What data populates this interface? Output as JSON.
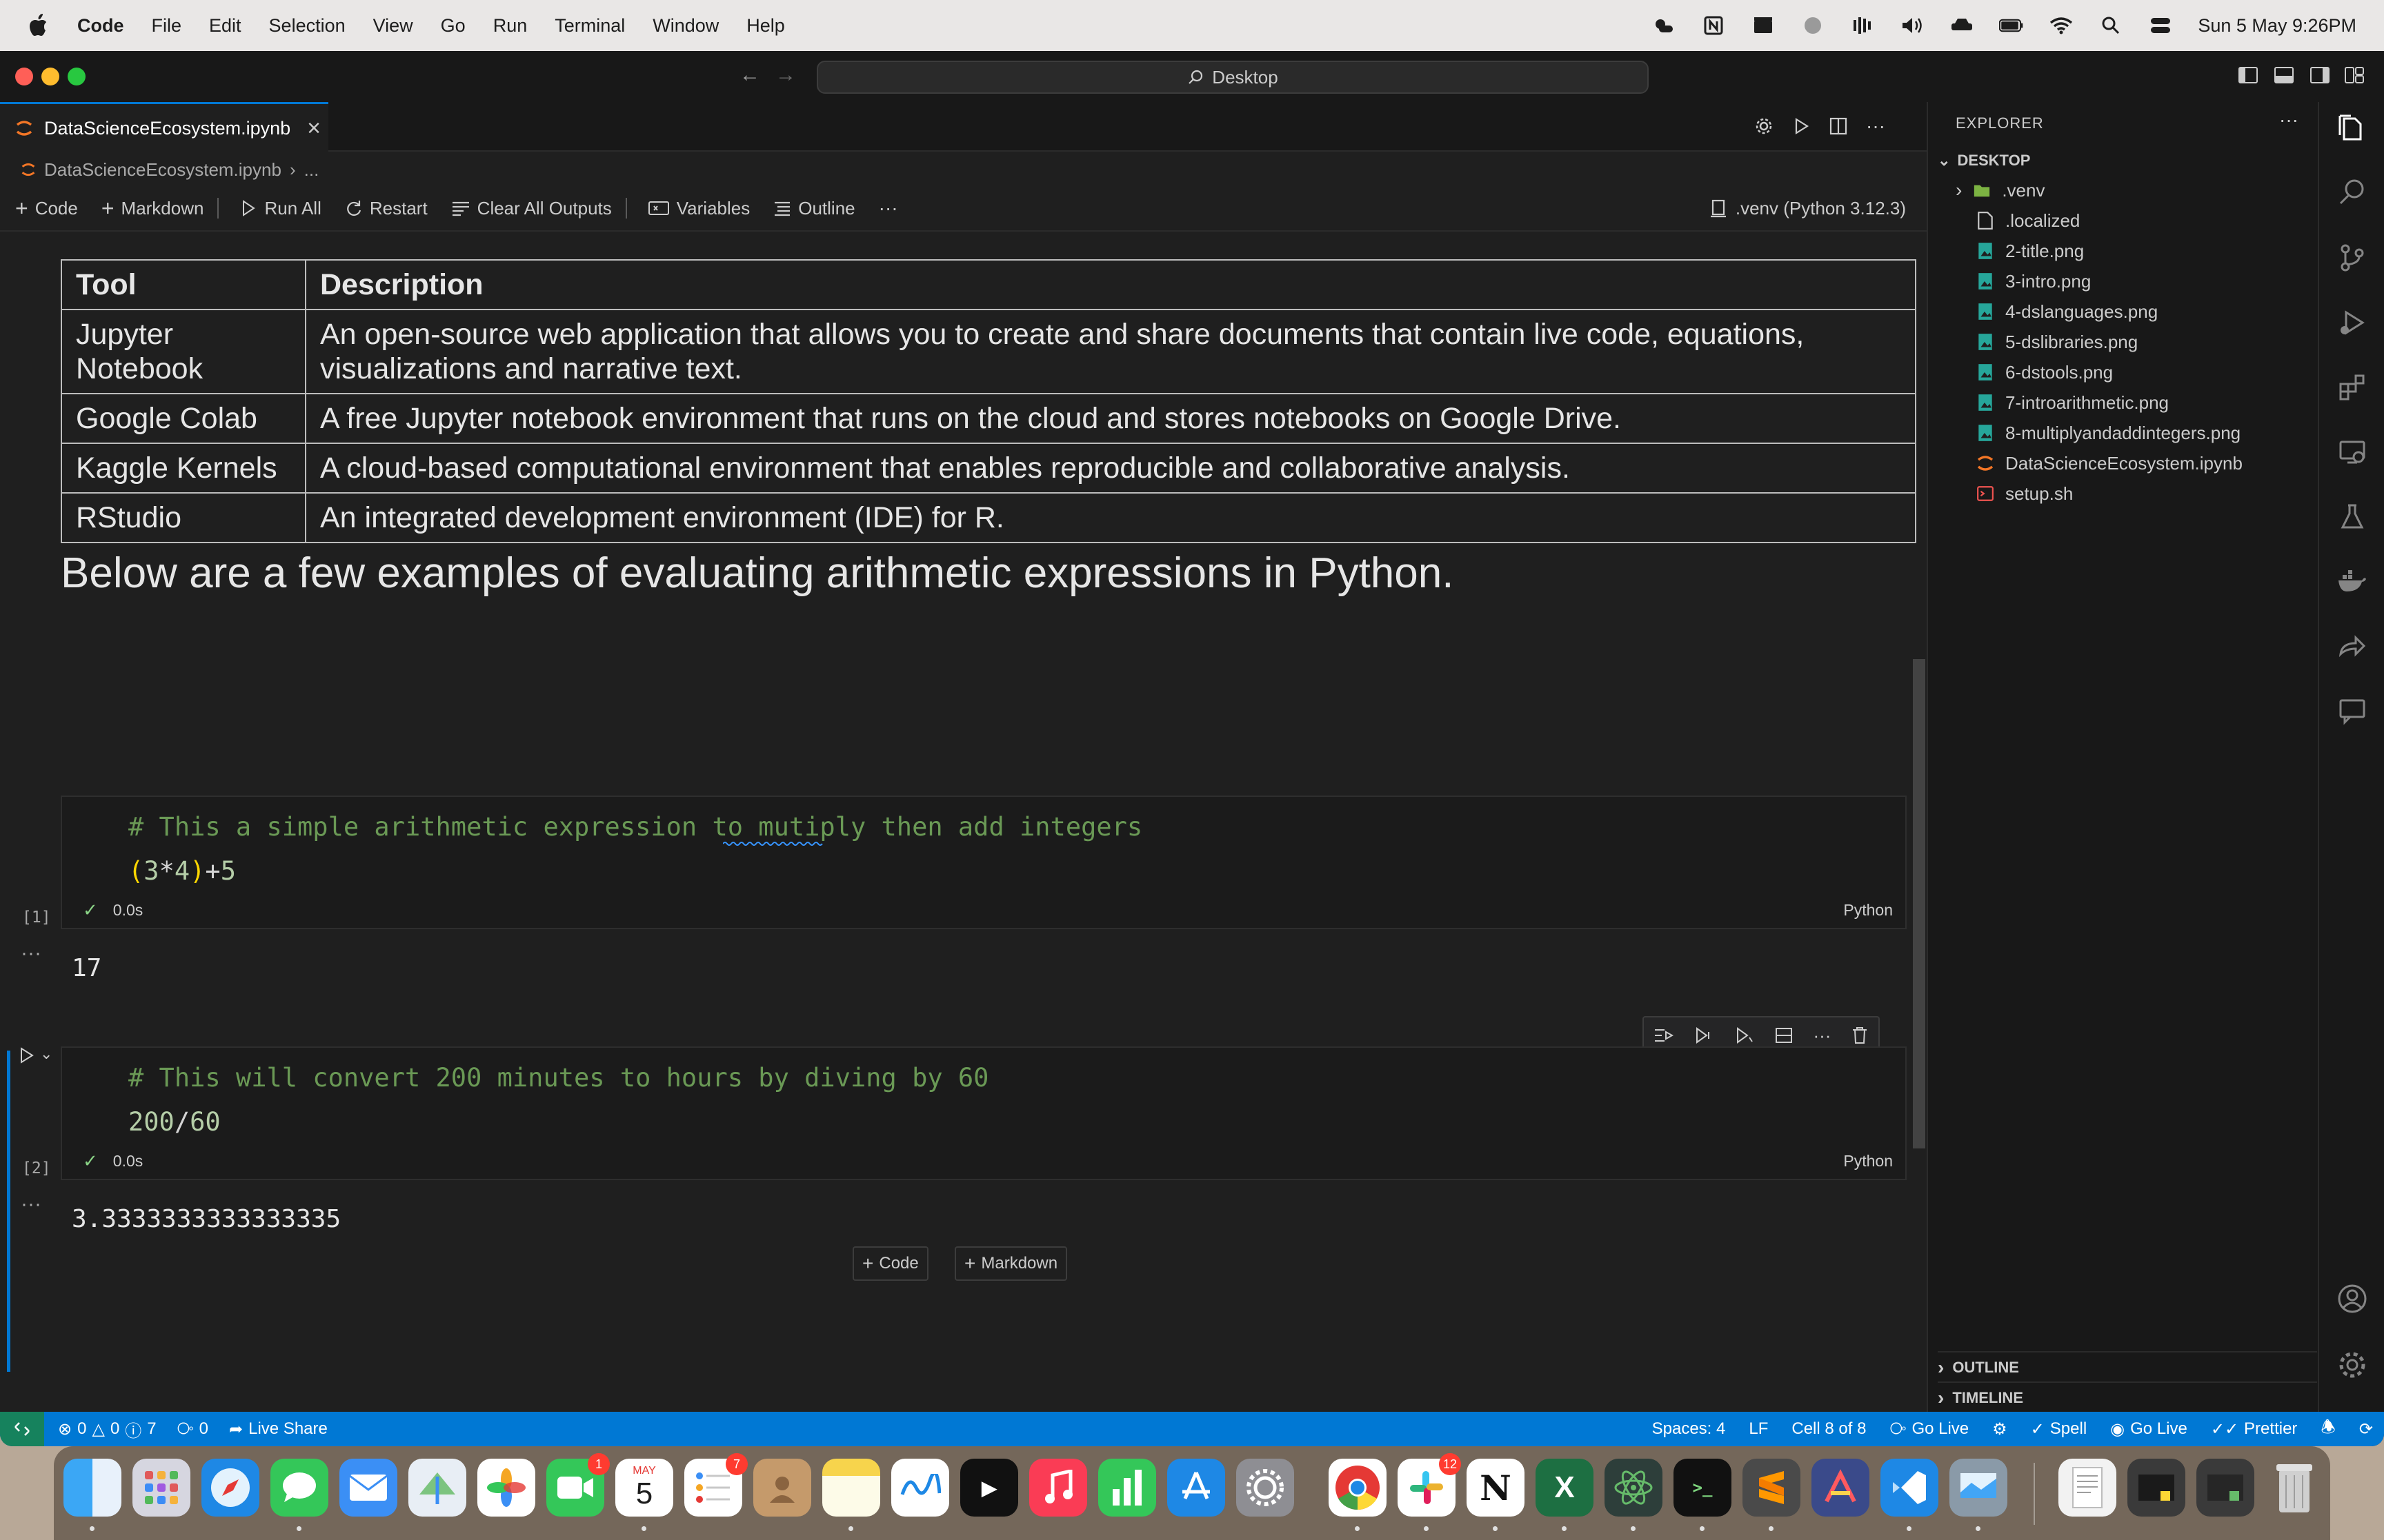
{
  "menubar": {
    "app": "Code",
    "items": [
      "File",
      "Edit",
      "Selection",
      "View",
      "Go",
      "Run",
      "Terminal",
      "Window",
      "Help"
    ],
    "clock": "Sun 5 May  9:26PM"
  },
  "titlebar": {
    "command_center": "Desktop"
  },
  "tab": {
    "title": "DataScienceEcosystem.ipynb"
  },
  "breadcrumb": {
    "file": "DataScienceEcosystem.ipynb",
    "more": "..."
  },
  "toolbar": {
    "code": "Code",
    "markdown": "Markdown",
    "run_all": "Run All",
    "restart": "Restart",
    "clear_outputs": "Clear All Outputs",
    "variables": "Variables",
    "outline": "Outline",
    "more": "···",
    "kernel": ".venv (Python 3.12.3)"
  },
  "table": {
    "headers": [
      "Tool",
      "Description"
    ],
    "rows": [
      [
        "Jupyter Notebook",
        "An open-source web application that allows you to create and share documents that contain live code, equations, visualizations and narrative text."
      ],
      [
        "Google Colab",
        "A free Jupyter notebook environment that runs on the cloud and stores notebooks on Google Drive."
      ],
      [
        "Kaggle Kernels",
        "A cloud-based computational environment that enables reproducible and collaborative analysis."
      ],
      [
        "RStudio",
        "An integrated development environment (IDE) for R."
      ]
    ]
  },
  "heading": "Below are a few examples of evaluating arithmetic expressions in Python.",
  "cells": [
    {
      "comment": "# This a simple arithmetic expression to mutiply then add integers",
      "code_open": "(",
      "code_a": "3",
      "code_op1": "*",
      "code_b": "4",
      "code_close": ")",
      "code_op2": "+",
      "code_c": "5",
      "exec_count": "[1]",
      "time": "0.0s",
      "lang": "Python",
      "output": "17"
    },
    {
      "comment": "# This will convert 200 minutes to hours by diving by 60",
      "code_a": "200",
      "code_op1": "/",
      "code_b": "60",
      "exec_count": "[2]",
      "time": "0.0s",
      "lang": "Python",
      "output": "3.3333333333333335"
    }
  ],
  "add_buttons": {
    "code": "Code",
    "markdown": "Markdown"
  },
  "explorer": {
    "title": "EXPLORER",
    "more": "···",
    "folder": "DESKTOP",
    "files": [
      ".venv",
      ".localized",
      "2-title.png",
      "3-intro.png",
      "4-dslanguages.png",
      "5-dslibraries.png",
      "6-dstools.png",
      "7-introarithmetic.png",
      "8-multiplyandaddintegers.png",
      "DataScienceEcosystem.ipynb",
      "setup.sh"
    ],
    "outline": "OUTLINE",
    "timeline": "TIMELINE"
  },
  "statusbar": {
    "errors": "0",
    "warnings": "0",
    "infos": "7",
    "ports": "0",
    "live_share": "Live Share",
    "spaces": "Spaces: 4",
    "eol": "LF",
    "cell": "Cell 8 of 8",
    "go_live_1": "Go Live",
    "spell": "Spell",
    "go_live_2": "Go Live",
    "prettier": "Prettier"
  },
  "dock": {
    "facetime_badge": "1",
    "calendar_month": "MAY",
    "calendar_day": "5",
    "reminders_badge": "7",
    "slack_badge": "12"
  },
  "colors": {
    "accent": "#0078d4",
    "comment": "#6a9955",
    "number": "#b5cea8",
    "statusbar": "#0078d4"
  }
}
